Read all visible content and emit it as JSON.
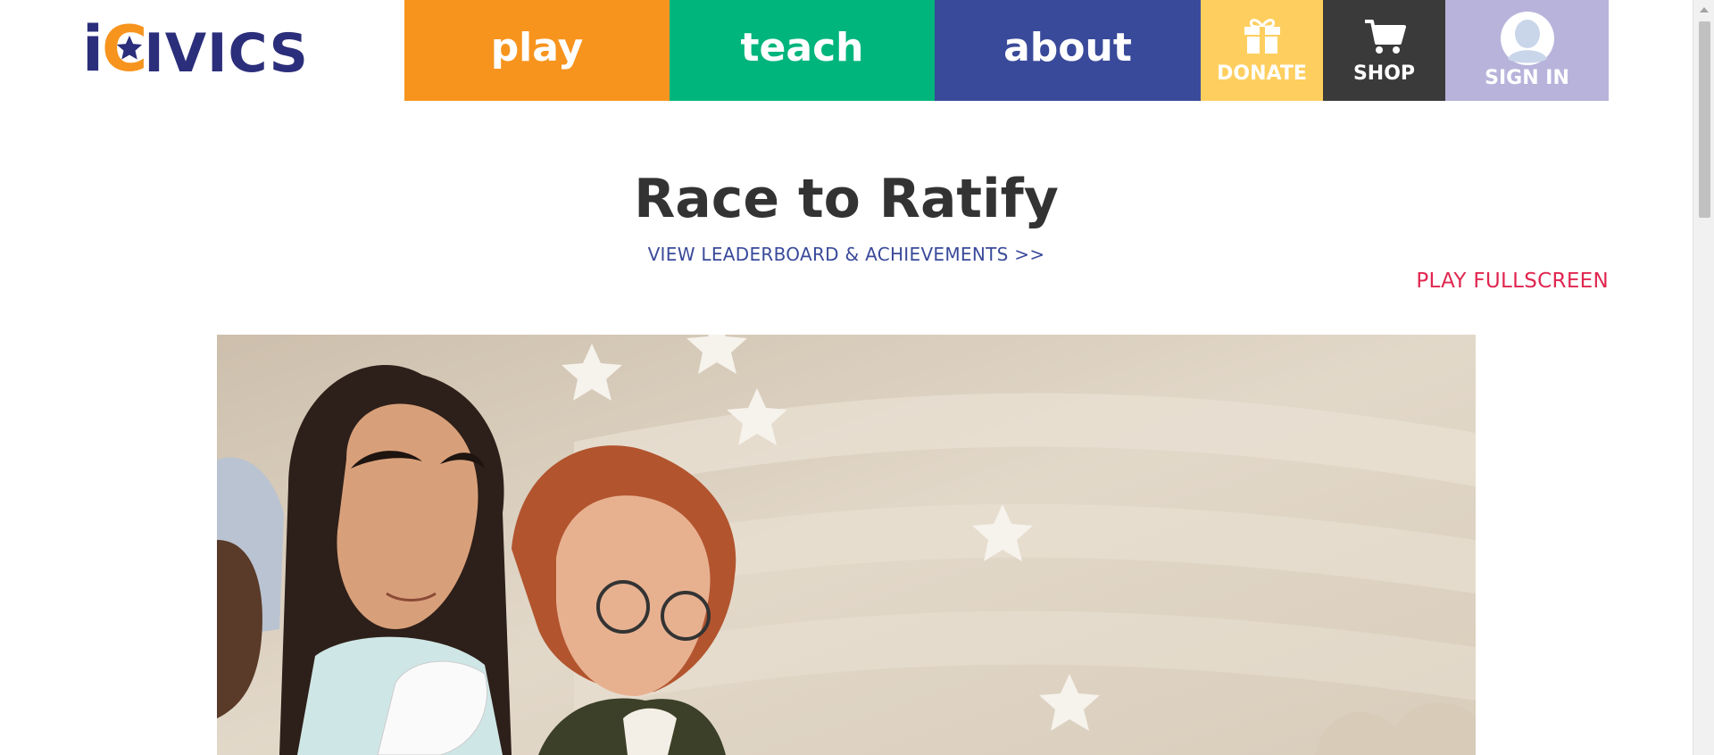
{
  "logo": {
    "first": "i",
    "star_letter": "C",
    "rest": "IVICS"
  },
  "nav": {
    "play": "play",
    "teach": "teach",
    "about": "about",
    "donate": "DONATE",
    "shop": "SHOP",
    "signin": "SIGN IN"
  },
  "page": {
    "title": "Race to Ratify",
    "leaderboard_link": "VIEW LEADERBOARD & ACHIEVEMENTS >>",
    "fullscreen_link": "PLAY FULLSCREEN"
  },
  "colors": {
    "play": "#f7941e",
    "teach": "#00b57c",
    "about": "#3a4a9a",
    "donate": "#fecf5f",
    "shop": "#3a3a3a",
    "signin": "#b8b3db",
    "fullscreen": "#e0264f",
    "brand_navy": "#2b2e7a"
  },
  "icons": {
    "donate": "gift-icon",
    "shop": "shopping-cart-icon",
    "signin": "user-avatar-icon",
    "logo_star": "star-icon"
  }
}
